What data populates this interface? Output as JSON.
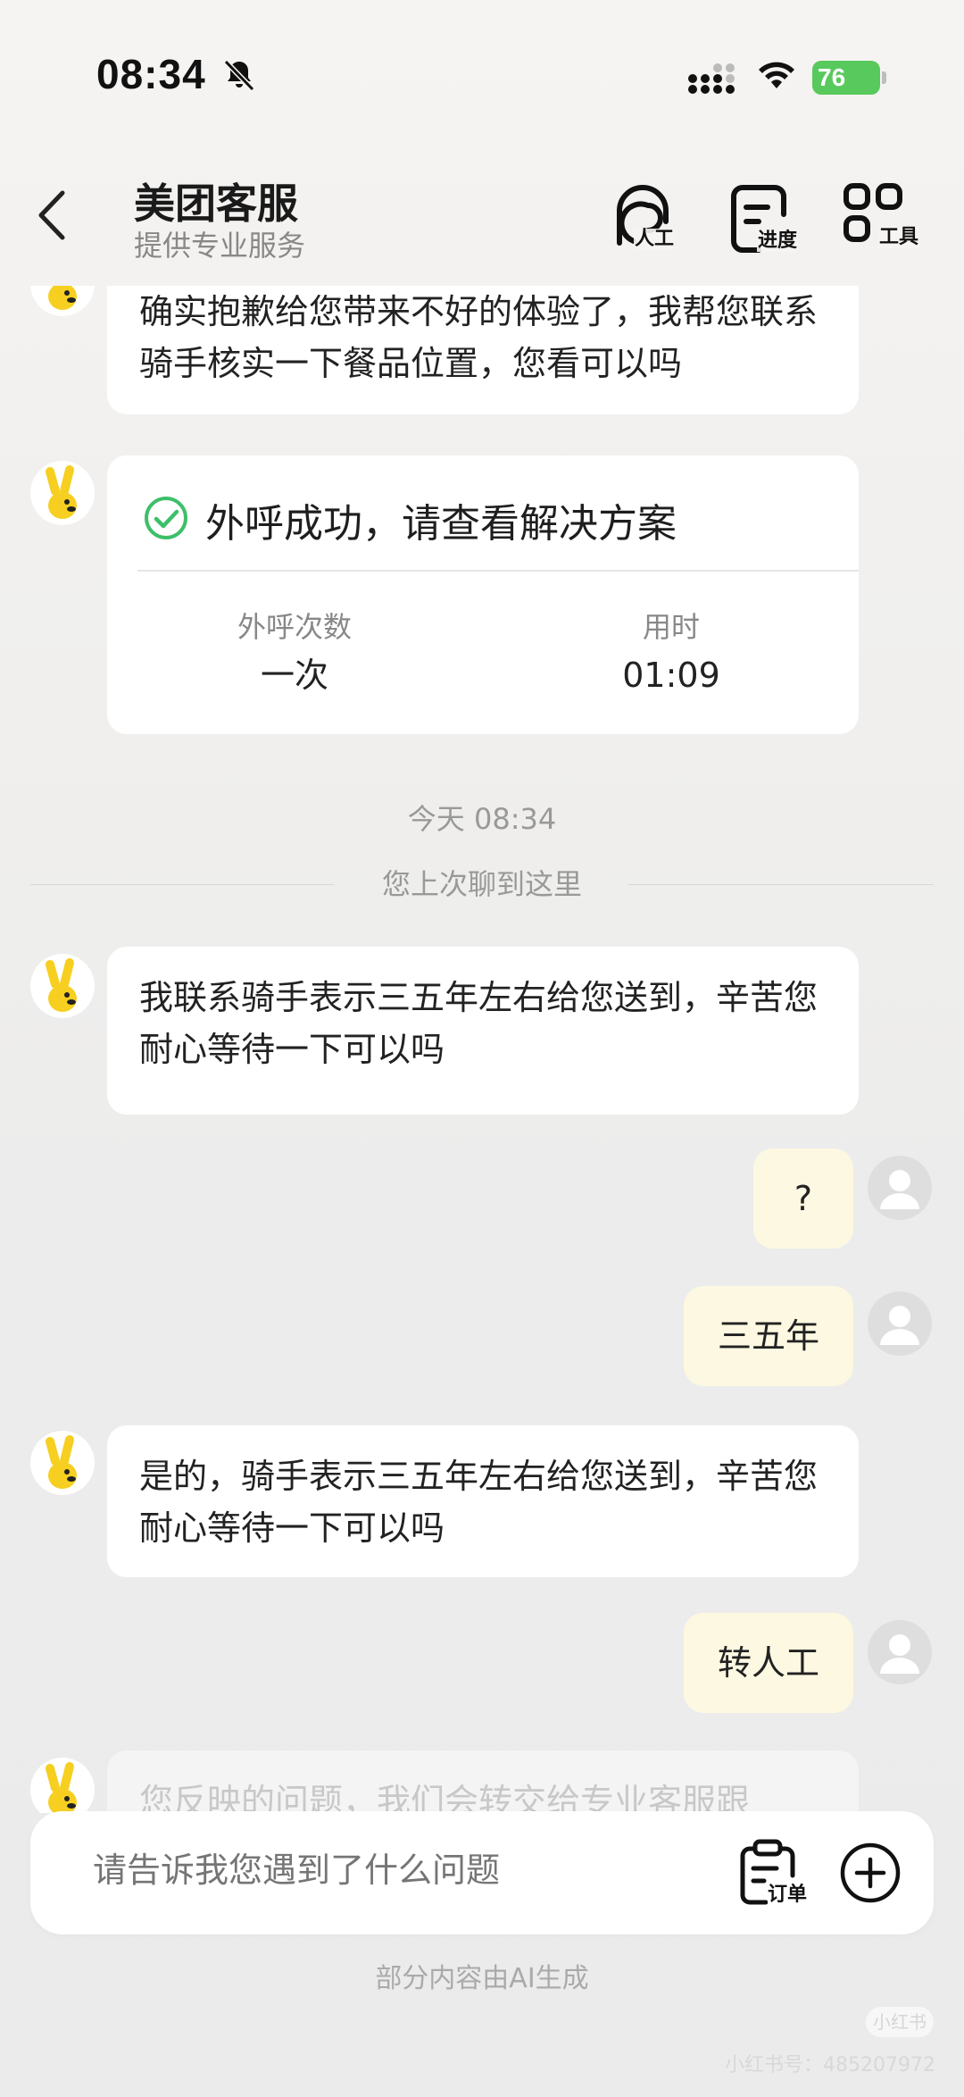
{
  "status_bar": {
    "time": "08:34",
    "battery": "76"
  },
  "nav": {
    "title": "美团客服",
    "subtitle": "提供专业服务",
    "actions": [
      {
        "label": "人工",
        "icon": "agent-headset-icon"
      },
      {
        "label": "进度",
        "icon": "progress-doc-icon"
      },
      {
        "label": "工具",
        "icon": "tools-grid-icon"
      }
    ]
  },
  "messages": {
    "bot_apology": "确实抱歉给您带来不好的体验了，我帮您联系骑手核实一下餐品位置，您看可以吗",
    "call_card": {
      "title": "外呼成功，请查看解决方案",
      "stats": [
        {
          "label": "外呼次数",
          "value": "一次"
        },
        {
          "label": "用时",
          "value": "01:09"
        }
      ]
    },
    "time_label": "今天 08:34",
    "divider": "您上次聊到这里",
    "bot_1": "我联系骑手表示三五年左右给您送到，辛苦您耐心等待一下可以吗",
    "user_1": "?",
    "user_2": "三五年",
    "bot_2": "是的，骑手表示三五年左右给您送到，辛苦您耐心等待一下可以吗",
    "user_3": "转人工",
    "bot_3_partial": "您反映的问题，我们会转交给专业客服跟"
  },
  "input": {
    "placeholder": "请告诉我您遇到了什么问题",
    "order_label": "订单"
  },
  "footer": {
    "ai_note": "部分内容由AI生成",
    "watermark_badge": "小红书",
    "watermark_id": "小红书号：485207972"
  },
  "colors": {
    "user_bubble": "#fdf8e1",
    "success_green": "#3dbf6a",
    "mascot_yellow": "#f6cf21"
  }
}
